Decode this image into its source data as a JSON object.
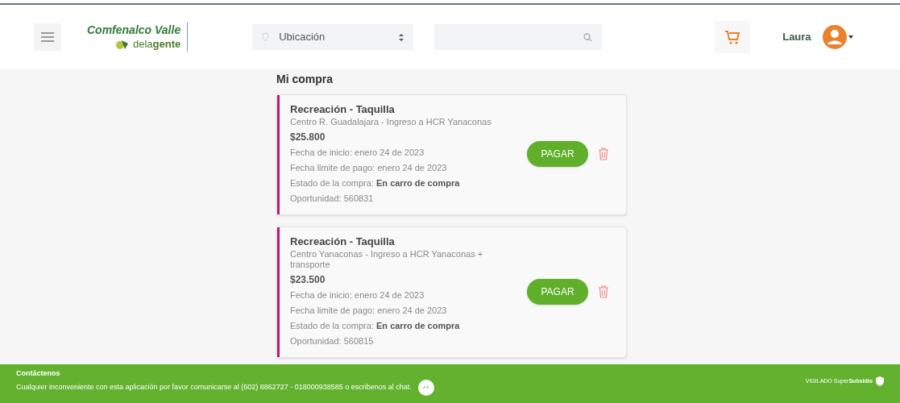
{
  "header": {
    "brand": "Comfenalco Valle",
    "tagline": "dela**gente**",
    "location": {
      "placeholder": "Ubicación"
    },
    "user": "Laura"
  },
  "page_title": "Mi compra",
  "purchases": [
    {
      "title": "Recreación - Taquilla",
      "place": "Centro R. Guadalajara - Ingreso a HCR Yanaconas",
      "price": "$25.800",
      "start": "Fecha de inicio: enero 24 de 2023",
      "deadline": "Fecha limite de pago: enero 24 de 2023",
      "status": "Estado de la compra: **En carro de compra**",
      "opportunity": "Oportunidad: 560831",
      "button": "PAGAR",
      "color": "#c0157c"
    },
    {
      "title": "Recreación - Taquilla",
      "place": "Centro Yanaconas - Ingreso a HCR Yanaconas + transporte",
      "price": "$23.500",
      "start": "Fecha de inicio: enero 24 de 2023",
      "deadline": "Fecha limite de pago: enero 24 de 2023",
      "status": "Estado de la compra: **En carro de compra**",
      "opportunity": "Oportunidad: 560815",
      "button": "PAGAR",
      "color": "#c0157c"
    }
  ],
  "footer": {
    "heading": "Contáctenos",
    "message": "Cualquier inconveniente con esta aplicación por favor comunicarse al (602) 8862727 - 018000938585 o escribenos al chat.",
    "vigilado": "VIGILADO Super**Subsidio**"
  }
}
